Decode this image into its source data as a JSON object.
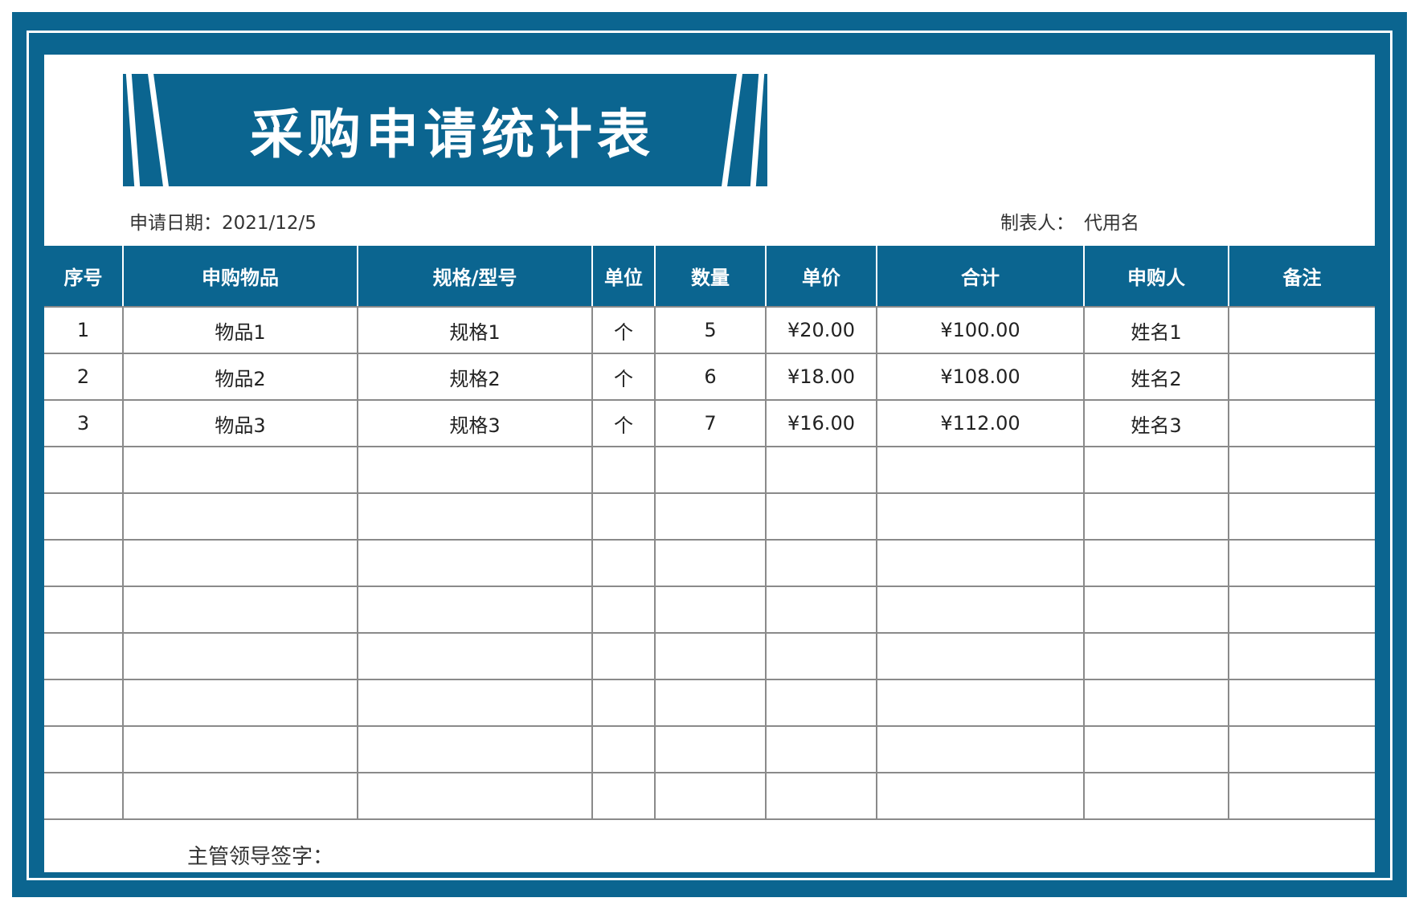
{
  "title": "采购申请统计表",
  "meta": {
    "date_label": "申请日期：",
    "date_value": "2021/12/5",
    "maker_label": "制表人：",
    "maker_value": "代用名"
  },
  "columns": [
    "序号",
    "申购物品",
    "规格/型号",
    "单位",
    "数量",
    "单价",
    "合计",
    "申购人",
    "备注"
  ],
  "rows": [
    [
      "1",
      "物品1",
      "规格1",
      "个",
      "5",
      "¥20.00",
      "¥100.00",
      "姓名1",
      ""
    ],
    [
      "2",
      "物品2",
      "规格2",
      "个",
      "6",
      "¥18.00",
      "¥108.00",
      "姓名2",
      ""
    ],
    [
      "3",
      "物品3",
      "规格3",
      "个",
      "7",
      "¥16.00",
      "¥112.00",
      "姓名3",
      ""
    ],
    [
      "",
      "",
      "",
      "",
      "",
      "",
      "",
      "",
      ""
    ],
    [
      "",
      "",
      "",
      "",
      "",
      "",
      "",
      "",
      ""
    ],
    [
      "",
      "",
      "",
      "",
      "",
      "",
      "",
      "",
      ""
    ],
    [
      "",
      "",
      "",
      "",
      "",
      "",
      "",
      "",
      ""
    ],
    [
      "",
      "",
      "",
      "",
      "",
      "",
      "",
      "",
      ""
    ],
    [
      "",
      "",
      "",
      "",
      "",
      "",
      "",
      "",
      ""
    ],
    [
      "",
      "",
      "",
      "",
      "",
      "",
      "",
      "",
      ""
    ],
    [
      "",
      "",
      "",
      "",
      "",
      "",
      "",
      "",
      ""
    ]
  ],
  "footer": {
    "signature_label": "主管领导签字："
  },
  "colors": {
    "accent": "#0b6590",
    "background": "#ffffff",
    "grid_line": "#8a8a8a"
  }
}
